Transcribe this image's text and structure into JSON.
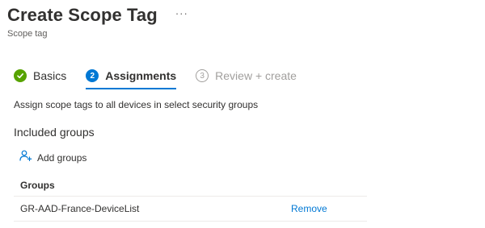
{
  "header": {
    "title": "Create Scope Tag",
    "more_icon": "more-icon",
    "subtitle": "Scope tag"
  },
  "wizard": {
    "steps": [
      {
        "number": "",
        "label": "Basics",
        "state": "done",
        "icon": "checkmark-circle-icon"
      },
      {
        "number": "2",
        "label": "Assignments",
        "state": "active"
      },
      {
        "number": "3",
        "label": "Review + create",
        "state": "pending"
      }
    ]
  },
  "main": {
    "description": "Assign scope tags to all devices in select security groups",
    "section_heading": "Included groups",
    "add_groups_label": "Add groups",
    "add_groups_icon": "add-user-icon",
    "table": {
      "columns": [
        "Groups"
      ],
      "rows": [
        {
          "group": "GR-AAD-France-DeviceList",
          "action": "Remove"
        }
      ]
    }
  },
  "colors": {
    "accent": "#0078d4",
    "success": "#57a300",
    "text": "#323130",
    "muted": "#a19f9d"
  }
}
